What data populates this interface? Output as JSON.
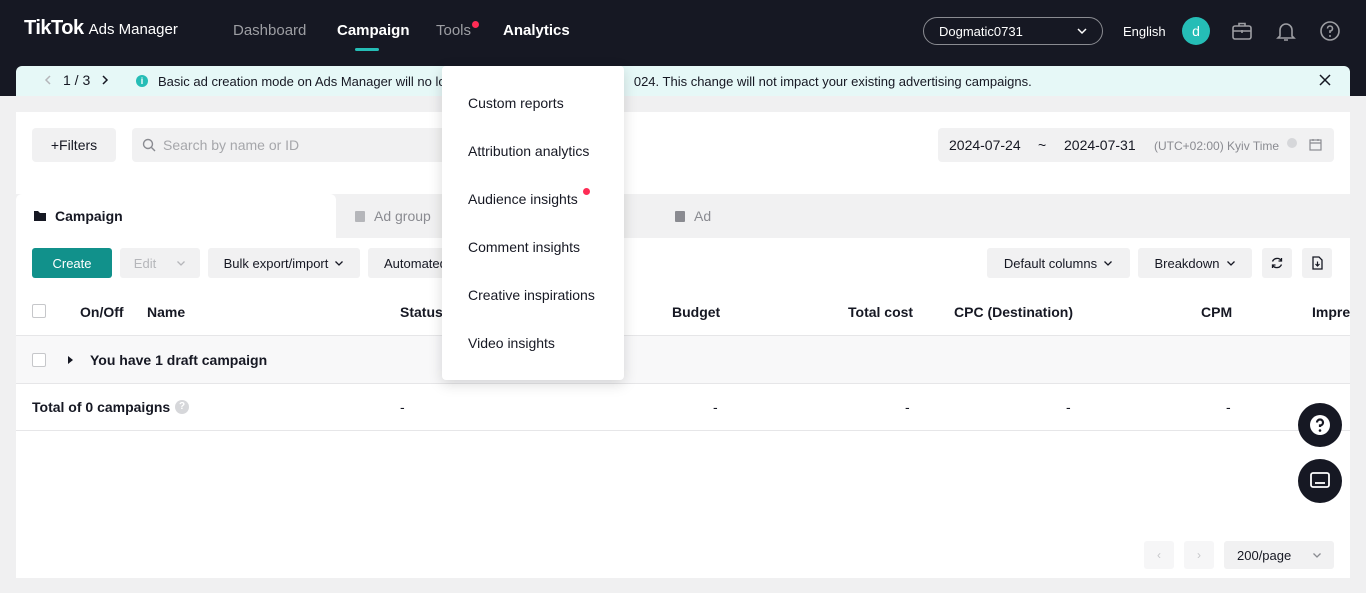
{
  "header": {
    "logo_main": "TikTok",
    "logo_sub": "Ads Manager",
    "nav": [
      "Dashboard",
      "Campaign",
      "Tools",
      "Analytics"
    ],
    "account": "Dogmatic0731",
    "language": "English",
    "avatar_letter": "d"
  },
  "notice": {
    "page_indicator": "1 / 3",
    "info_glyph": "i",
    "message_left": "Basic ad creation mode on Ads Manager will no lon",
    "message_right": "024. This change will not impact your existing advertising campaigns."
  },
  "filters": {
    "filters_label": "Filters",
    "search_placeholder": "Search by name or ID",
    "date_start": "2024-07-24",
    "date_sep": "~",
    "date_end": "2024-07-31",
    "timezone": "(UTC+02:00) Kyiv Time"
  },
  "tabs": [
    "Campaign",
    "Ad group",
    "Ad"
  ],
  "toolbar": {
    "create": "Create",
    "edit": "Edit",
    "bulk": "Bulk export/import",
    "automated": "Automated",
    "default_columns": "Default columns",
    "breakdown": "Breakdown"
  },
  "table": {
    "headers": [
      "On/Off",
      "Name",
      "Status",
      "Budget",
      "Total cost",
      "CPC (Destination)",
      "CPM",
      "Impre"
    ],
    "draft_row": "You have 1 draft campaign",
    "total_label": "Total of 0 campaigns",
    "total_values": [
      "-",
      "-",
      "-",
      "-",
      "-"
    ]
  },
  "pagination": {
    "page_size": "200/page"
  },
  "analytics_menu": {
    "items": [
      "Custom reports",
      "Attribution analytics",
      "Audience insights",
      "Comment insights",
      "Creative inspirations",
      "Video insights"
    ]
  },
  "colors": {
    "topbar": "#161823",
    "accent": "#25bdb6",
    "create_button": "#11918b",
    "notification_dot": "#fe2c55"
  },
  "icons": [
    "chevron-down-icon",
    "briefcase-icon",
    "bell-icon",
    "help-icon",
    "info-icon",
    "close-icon",
    "search-icon",
    "calendar-icon",
    "folder-icon",
    "refresh-icon",
    "export-icon",
    "caret-right-icon",
    "chat-icon"
  ]
}
